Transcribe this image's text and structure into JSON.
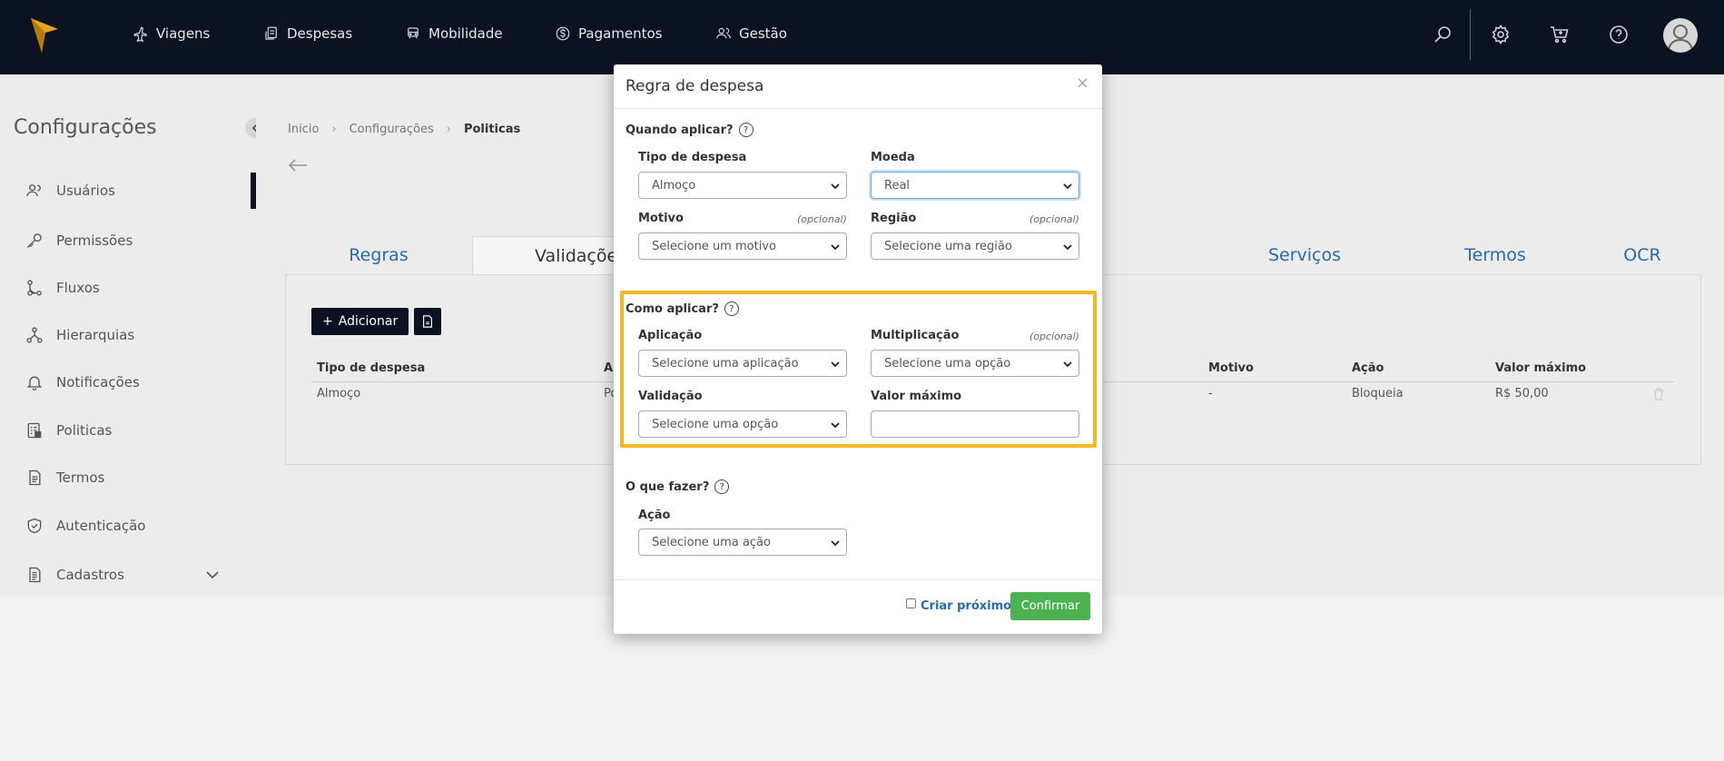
{
  "topnav": {
    "items": [
      {
        "label": "Viagens",
        "icon": "plane-icon"
      },
      {
        "label": "Despesas",
        "icon": "receipt-icon"
      },
      {
        "label": "Mobilidade",
        "icon": "car-icon"
      },
      {
        "label": "Pagamentos",
        "icon": "dollar-icon"
      },
      {
        "label": "Gestão",
        "icon": "users-icon"
      }
    ],
    "right_icons": [
      "search-icon",
      "gear-icon",
      "cart-icon",
      "help-icon"
    ]
  },
  "sidebar": {
    "title": "Configurações",
    "items": [
      {
        "label": "Usuários",
        "icon": "users-icon"
      },
      {
        "label": "Permissões",
        "icon": "key-icon"
      },
      {
        "label": "Fluxos",
        "icon": "flow-icon"
      },
      {
        "label": "Hierarquias",
        "icon": "hierarchy-icon"
      },
      {
        "label": "Notificações",
        "icon": "bell-icon"
      },
      {
        "label": "Politicas",
        "icon": "policy-icon"
      },
      {
        "label": "Termos",
        "icon": "document-icon"
      },
      {
        "label": "Autenticação",
        "icon": "shield-icon"
      },
      {
        "label": "Cadastros",
        "icon": "register-icon"
      }
    ]
  },
  "breadcrumb": {
    "items": [
      "Inicio",
      "Configurações",
      "Politicas"
    ]
  },
  "tabs": [
    "Regras",
    "Validações",
    "Serviços",
    "Termos",
    "OCR"
  ],
  "panel": {
    "add_label": "Adicionar",
    "columns": [
      "Tipo de despesa",
      "A",
      "Motivo",
      "Ação",
      "Valor máximo"
    ],
    "row": [
      "Almoço",
      "Po",
      "-",
      "Bloqueia",
      "R$ 50,00"
    ]
  },
  "modal": {
    "title": "Regra de despesa",
    "close": "×",
    "when": {
      "title": "Quando aplicar?",
      "tipo_label": "Tipo de despesa",
      "tipo_value": "Almoço",
      "moeda_label": "Moeda",
      "moeda_value": "Real",
      "motivo_label": "Motivo",
      "motivo_opt": "(opcional)",
      "motivo_value": "Selecione um motivo",
      "regiao_label": "Região",
      "regiao_opt": "(opcional)",
      "regiao_value": "Selecione uma região"
    },
    "how": {
      "title": "Como aplicar?",
      "aplicacao_label": "Aplicação",
      "aplicacao_value": "Selecione uma aplicação",
      "multi_label": "Multiplicação",
      "multi_opt": "(opcional)",
      "multi_value": "Selecione uma opção",
      "validacao_label": "Validação",
      "validacao_value": "Selecione uma opção",
      "valor_label": "Valor máximo",
      "valor_value": ""
    },
    "what": {
      "title": "O que fazer?",
      "acao_label": "Ação",
      "acao_value": "Selecione uma ação"
    },
    "footer": {
      "next_label": "Criar próximo",
      "confirm_label": "Confirmar"
    }
  },
  "colors": {
    "nav_bg": "#0b1222",
    "link": "#2c6aa6",
    "highlight": "#f3b824",
    "confirm": "#4cb150"
  }
}
